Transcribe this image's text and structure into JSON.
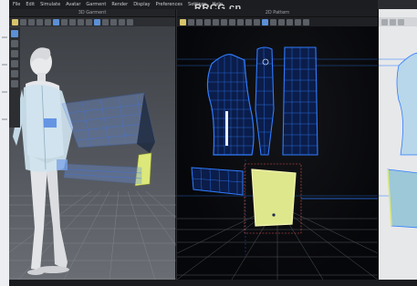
{
  "menu": {
    "items": [
      "File",
      "Edit",
      "Simulate",
      "Avatar",
      "Garment",
      "Render",
      "Display",
      "Preferences",
      "Settings",
      "Help"
    ]
  },
  "watermark": "RRCG.cn",
  "panels": {
    "left_title": "3D Garment",
    "middle_title": "2D Pattern"
  },
  "icons": {
    "toolbar_3d": [
      "select-icon",
      "move-icon",
      "fold-icon",
      "pin-icon",
      "tack-icon",
      "measure-icon",
      "camera-icon",
      "light-icon",
      "avatar-icon",
      "grid-icon",
      "layer-icon",
      "shading-icon",
      "texture-icon",
      "sewing-icon",
      "undo-icon"
    ],
    "toolbar_2d": [
      "select-pattern-icon",
      "transform-icon",
      "edit-point-icon",
      "add-point-icon",
      "curve-icon",
      "polygon-icon",
      "rectangle-icon",
      "circle-icon",
      "dart-icon",
      "internal-line-icon",
      "segment-sew-icon",
      "free-sew-icon",
      "fold-arrange-icon",
      "notch-icon",
      "grainline-icon",
      "symmetry-icon"
    ]
  },
  "colors": {
    "pattern_blue": "#2f7cff",
    "selected_yellow": "#e9ec8a",
    "sleeve_cuff": "#d9e77a"
  }
}
